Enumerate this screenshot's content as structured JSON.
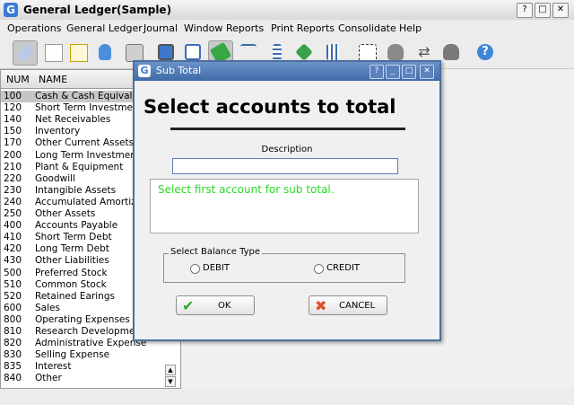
{
  "window": {
    "title": "General Ledger(Sample)",
    "controls": [
      "?",
      "□",
      "✕"
    ]
  },
  "menu": [
    "Operations",
    "General Ledger",
    "Journal",
    "Window",
    "Reports",
    "Print Reports",
    "Consolidate",
    "Help"
  ],
  "toolbar_icons": [
    "eraser-icon",
    "new-document-icon",
    "edit-document-icon",
    "database-icon",
    "printer-icon",
    "monitor-icon",
    "window-icon",
    "money-icon",
    "balance-scale-icon",
    "ledger-list-icon",
    "money-arrow-icon",
    "journal-icon",
    "selection-icon",
    "database-export-icon",
    "swap-arrows-icon",
    "database-down-icon",
    "help-icon"
  ],
  "accounts_table": {
    "columns": [
      "NUM",
      "NAME"
    ],
    "rows": [
      {
        "num": "100",
        "name": "Cash & Cash Equivalents"
      },
      {
        "num": "120",
        "name": "Short Term Investments"
      },
      {
        "num": "140",
        "name": "Net Receivables"
      },
      {
        "num": "150",
        "name": "Inventory"
      },
      {
        "num": "170",
        "name": "Other Current Assets"
      },
      {
        "num": "200",
        "name": "Long Term Investments"
      },
      {
        "num": "210",
        "name": "Plant & Equipment"
      },
      {
        "num": "220",
        "name": "Goodwill"
      },
      {
        "num": "230",
        "name": "Intangible Assets"
      },
      {
        "num": "240",
        "name": "Accumulated Amortization"
      },
      {
        "num": "250",
        "name": "Other Assets"
      },
      {
        "num": "400",
        "name": "Accounts Payable"
      },
      {
        "num": "410",
        "name": "Short Term Debt"
      },
      {
        "num": "420",
        "name": "Long Term Debt"
      },
      {
        "num": "430",
        "name": "Other Liabilities"
      },
      {
        "num": "500",
        "name": "Preferred Stock"
      },
      {
        "num": "510",
        "name": "Common Stock"
      },
      {
        "num": "520",
        "name": "Retained Earings"
      },
      {
        "num": "600",
        "name": "Sales"
      },
      {
        "num": "800",
        "name": "Operating Expenses"
      },
      {
        "num": "810",
        "name": "Research Development"
      },
      {
        "num": "820",
        "name": "Administrative Expense"
      },
      {
        "num": "830",
        "name": "Selling Expense"
      },
      {
        "num": "835",
        "name": "Interest"
      },
      {
        "num": "840",
        "name": "Other"
      }
    ],
    "selected_index": 0
  },
  "dialog": {
    "title": "Sub Total",
    "controls": [
      "?",
      "_",
      "□",
      "✕"
    ],
    "heading": "Select accounts to total",
    "description_label": "Description",
    "description_value": "",
    "message": "Select first account for sub total.",
    "balance_type_label": "Select Balance Type",
    "options": [
      "DEBIT",
      "CREDIT"
    ],
    "ok_label": "OK",
    "cancel_label": "CANCEL"
  },
  "colors": {
    "dialog_title_bar": "#4f78b3",
    "message_text": "#28d928",
    "ok_check": "#2fa52f",
    "cancel_x": "#e0502a"
  }
}
